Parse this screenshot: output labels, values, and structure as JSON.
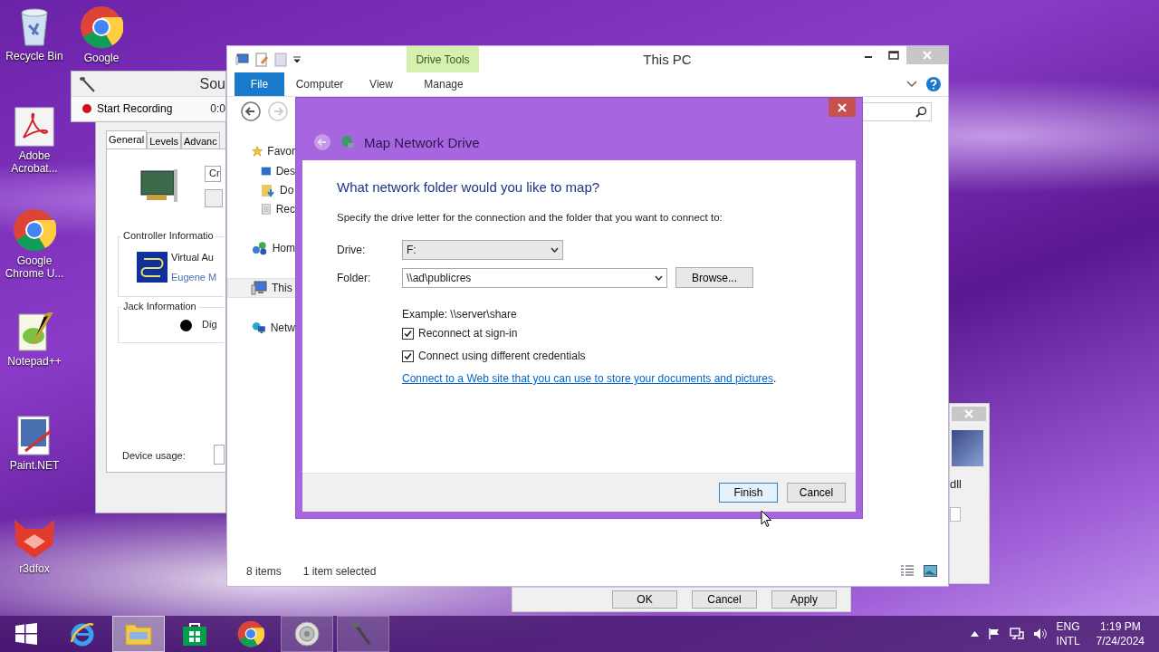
{
  "desktop_icons": [
    {
      "label": "Recycle Bin",
      "kind": "recycle"
    },
    {
      "label": "Google",
      "kind": "chrome"
    },
    {
      "label": "Adobe Acrobat...",
      "kind": "pdf"
    },
    {
      "label": "Google Chrome U...",
      "kind": "chrome"
    },
    {
      "label": "Notepad++",
      "kind": "notepad"
    },
    {
      "label": "Paint.NET",
      "kind": "paint"
    },
    {
      "label": "r3dfox",
      "kind": "fox"
    }
  ],
  "recorder": {
    "title": "Sou",
    "record_button": "Start Recording",
    "time": "0:0"
  },
  "properties": {
    "tabs": [
      {
        "label": "General",
        "selected": true
      },
      {
        "label": "Levels",
        "selected": false
      },
      {
        "label": "Advanc",
        "selected": false
      }
    ],
    "device_field": "Cr",
    "controller_group": {
      "title": "Controller Informatio",
      "name": "Virtual Au",
      "link": "Eugene M"
    },
    "jack_group": {
      "title": "Jack Information",
      "jack": "Dig"
    },
    "device_usage_label": "Device usage:"
  },
  "explorer": {
    "title": "This PC",
    "context_group": "Drive Tools",
    "file_tab": "File",
    "ribbon_tabs": [
      {
        "label": "Computer"
      },
      {
        "label": "View"
      },
      {
        "label": "Manage"
      }
    ],
    "nav": [
      {
        "label": "Favor",
        "kind": "star",
        "selected": false,
        "children": [
          {
            "label": "Des",
            "kind": "desktop",
            "selected": false
          },
          {
            "label": "Do",
            "kind": "downloads",
            "selected": false
          },
          {
            "label": "Rec",
            "kind": "recent",
            "selected": false
          }
        ]
      },
      {
        "label": "Hom",
        "kind": "homegroup",
        "selected": false
      },
      {
        "label": "This",
        "kind": "computer",
        "selected": true
      },
      {
        "label": "Netw",
        "kind": "network",
        "selected": false
      }
    ],
    "status": {
      "items": "8 items",
      "selected": "1 item selected"
    }
  },
  "dialog": {
    "title": "Map Network Drive",
    "heading": "What network folder would you like to map?",
    "instruction": "Specify the drive letter for the connection and the folder that you want to connect to:",
    "drive_label": "Drive:",
    "drive_value": "F:",
    "folder_label": "Folder:",
    "folder_value": "\\\\ad\\publicres",
    "browse_button": "Browse...",
    "example": "Example: \\\\server\\share",
    "options": [
      {
        "label": "Reconnect at sign-in",
        "checked": true
      },
      {
        "label": "Connect using different credentials",
        "checked": true
      }
    ],
    "link": "Connect to a Web site that you can use to store your documents and pictures",
    "link_end": ".",
    "buttons": [
      {
        "label": "Finish",
        "kind": "default"
      },
      {
        "label": "Cancel",
        "kind": "normal"
      }
    ]
  },
  "side_window": {
    "text": "dll"
  },
  "back_window": {
    "buttons": [
      "OK",
      "Cancel",
      "Apply"
    ]
  },
  "taskbar": {
    "apps": [
      {
        "kind": "start",
        "open": false,
        "selected": false
      },
      {
        "kind": "ie",
        "open": false,
        "selected": false
      },
      {
        "kind": "explorer",
        "open": true,
        "selected": true
      },
      {
        "kind": "store",
        "open": false,
        "selected": false
      },
      {
        "kind": "chrome",
        "open": false,
        "selected": false
      },
      {
        "kind": "speaker",
        "open": true,
        "selected": false
      },
      {
        "kind": "mic",
        "open": true,
        "selected": false
      }
    ],
    "language": "ENG",
    "layout": "INTL",
    "time": "1:19 PM",
    "date": "7/24/2024"
  }
}
